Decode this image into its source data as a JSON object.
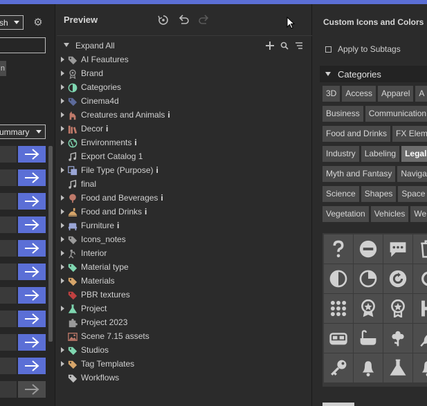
{
  "colors": {
    "accent": "#5b6fd6",
    "panel": "#2b2b2b"
  },
  "left": {
    "top_select_value": "sh",
    "settings_icon": "gear-icon",
    "chip_text": "n",
    "summary_select_value": "ummary",
    "rows": 11,
    "row_icon": "arrow-right-icon"
  },
  "preview": {
    "title": "Preview",
    "toolbar": [
      "reset-icon",
      "undo-icon",
      "redo-icon"
    ],
    "expand_all": "Expand All",
    "expand_tools": [
      "plus-icon",
      "search-icon",
      "sort-icon"
    ],
    "items": [
      {
        "label": "AI Feautures",
        "icon": "tag-icon",
        "color": "#9a9a9a",
        "arrow": true,
        "info": ""
      },
      {
        "label": "Brand",
        "icon": "medal-icon",
        "color": "#9a9a9a",
        "arrow": true,
        "info": ""
      },
      {
        "label": "Categories",
        "icon": "half-circle-icon",
        "color": "#7fd6b0",
        "arrow": true,
        "info": ""
      },
      {
        "label": "Cinema4d",
        "icon": "tag-icon",
        "color": "#5c6a9a",
        "arrow": true,
        "info": ""
      },
      {
        "label": "Creatures and Animals",
        "icon": "creature-icon",
        "color": "#c07a6a",
        "arrow": true,
        "info": "i"
      },
      {
        "label": "Decor",
        "icon": "books-icon",
        "color": "#c07a6a",
        "arrow": true,
        "info": "i"
      },
      {
        "label": "Environments",
        "icon": "globe-icon",
        "color": "#7fd6b0",
        "arrow": true,
        "info": "i"
      },
      {
        "label": "Export Catalog 1",
        "icon": "music-icon",
        "color": "#bdbdbd",
        "arrow": false,
        "info": ""
      },
      {
        "label": "File Type (Purpose)",
        "icon": "files-icon",
        "color": "#9aa6d6",
        "arrow": true,
        "info": "i"
      },
      {
        "label": "final",
        "icon": "music-icon",
        "color": "#bdbdbd",
        "arrow": false,
        "info": ""
      },
      {
        "label": "Food and Beverages",
        "icon": "tree-icon",
        "color": "#c07a6a",
        "arrow": true,
        "info": "i"
      },
      {
        "label": "Food and Drinks",
        "icon": "food-icon",
        "color": "#d6a56a",
        "arrow": true,
        "info": "i"
      },
      {
        "label": "Furniture",
        "icon": "chair-icon",
        "color": "#9aa6d6",
        "arrow": true,
        "info": "i"
      },
      {
        "label": "Icons_notes",
        "icon": "tag-icon",
        "color": "#9a9a9a",
        "arrow": true,
        "info": ""
      },
      {
        "label": "Interior",
        "icon": "figure-icon",
        "color": "#9a9a9a",
        "arrow": true,
        "info": ""
      },
      {
        "label": "Material type",
        "icon": "tag-icon",
        "color": "#7fd6b0",
        "arrow": true,
        "info": ""
      },
      {
        "label": "Materials",
        "icon": "tag-icon",
        "color": "#d6a56a",
        "arrow": true,
        "info": ""
      },
      {
        "label": "PBR textures",
        "icon": "tag-icon",
        "color": "#c04040",
        "arrow": false,
        "info": ""
      },
      {
        "label": "Project",
        "icon": "flask-icon",
        "color": "#7fd6b0",
        "arrow": true,
        "info": ""
      },
      {
        "label": "Project 2023",
        "icon": "puzzle-icon",
        "color": "#9a9a9a",
        "arrow": false,
        "info": ""
      },
      {
        "label": "Scene 7.15 assets",
        "icon": "image-icon",
        "color": "#c07a6a",
        "arrow": false,
        "info": ""
      },
      {
        "label": "Studios",
        "icon": "tag-icon",
        "color": "#7fd6b0",
        "arrow": true,
        "info": ""
      },
      {
        "label": "Tag Templates",
        "icon": "tag-icon",
        "color": "#d6a56a",
        "arrow": true,
        "info": ""
      },
      {
        "label": "Workflows",
        "icon": "tag-icon",
        "color": "#bdbdbd",
        "arrow": false,
        "info": ""
      }
    ]
  },
  "right": {
    "title": "Custom Icons and Colors",
    "apply_subtags": "Apply to Subtags",
    "categories_label": "Categories",
    "chip_rows": [
      [
        "3D",
        "Access",
        "Apparel",
        "A"
      ],
      [
        "Business",
        "Communication"
      ],
      [
        "Food and Drinks",
        "FX Elem"
      ],
      [
        "Industry",
        "Labeling",
        "Legal"
      ],
      [
        "Myth and Fantasy",
        "Naviga"
      ],
      [
        "Science",
        "Shapes",
        "Space"
      ],
      [
        "Vegetation",
        "Vehicles",
        "We"
      ]
    ],
    "active_chip": "Legal",
    "icon_grid": [
      [
        "question-icon",
        "minus-circle-icon",
        "chat-icon",
        "trash-icon"
      ],
      [
        "contrast-icon",
        "pie-icon",
        "refresh-icon",
        "ring-icon"
      ],
      [
        "dots-grid-icon",
        "award-icon",
        "badge-icon",
        "letter-h-icon"
      ],
      [
        "bed-icon",
        "bathtub-icon",
        "flower-icon",
        "leaf-icon"
      ],
      [
        "key-icon",
        "bell-icon",
        "flask-icon",
        "bell-icon"
      ]
    ]
  }
}
